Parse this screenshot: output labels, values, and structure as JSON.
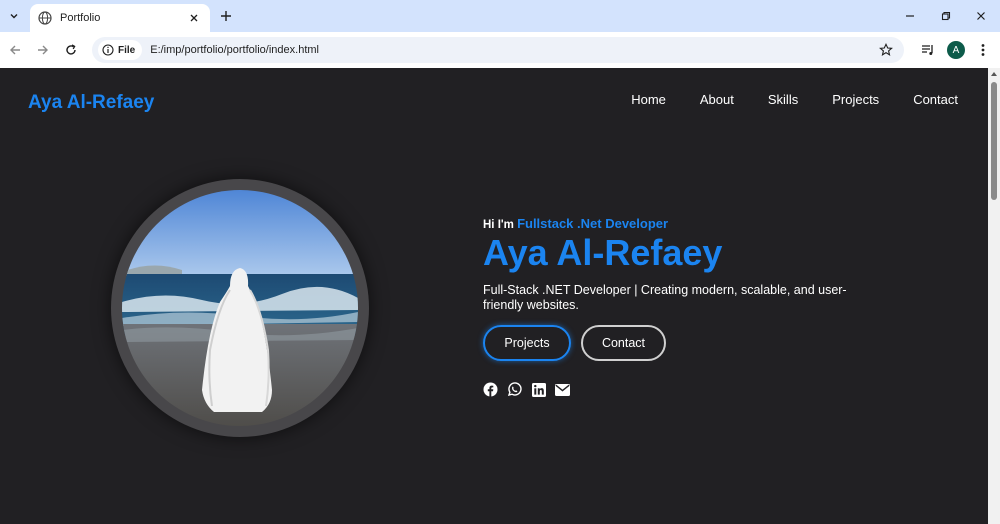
{
  "browser": {
    "tab_title": "Portfolio",
    "chip_label": "File",
    "url": "E:/imp/portfolio/portfolio/index.html",
    "profile_initial": "A",
    "icons": [
      "tab-search-icon",
      "globe-icon",
      "close-icon",
      "plus-icon",
      "minimize-icon",
      "restore-icon",
      "back-icon",
      "forward-icon",
      "reload-icon",
      "info-icon",
      "star-icon",
      "media-icon",
      "menu-icon"
    ]
  },
  "site": {
    "logo": "Aya Al-Refaey",
    "nav": [
      "Home",
      "About",
      "Skills",
      "Projects",
      "Contact"
    ],
    "hero": {
      "greeting": "Hi I'm",
      "role": "Fullstack .Net Developer",
      "name": "Aya Al-Refaey",
      "description": "Full-Stack .NET Developer | Creating modern, scalable, and user-friendly websites.",
      "buttons": {
        "projects": "Projects",
        "contact": "Contact"
      },
      "socials": [
        "facebook-icon",
        "whatsapp-icon",
        "linkedin-icon",
        "email-icon"
      ]
    },
    "colors": {
      "accent": "#1b84f0",
      "background": "#212023",
      "ring": "#48474a"
    }
  }
}
